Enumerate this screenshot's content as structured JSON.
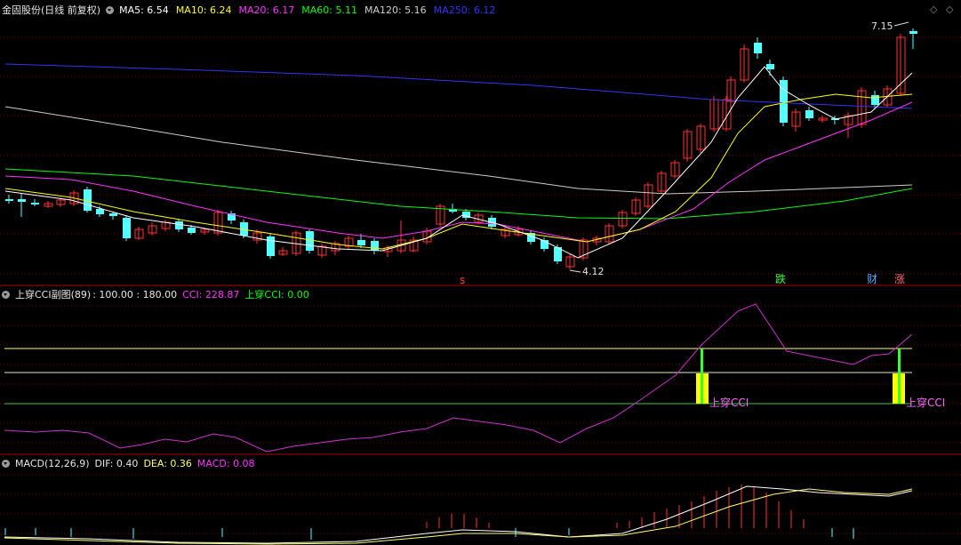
{
  "main": {
    "stock_name": "金固股份",
    "period": "(日线 前复权)",
    "ma": [
      {
        "label": "MA5:",
        "value": "6.54",
        "color": "#ffffff"
      },
      {
        "label": "MA10:",
        "value": "6.24",
        "color": "#ffff00"
      },
      {
        "label": "MA20:",
        "value": "6.17",
        "color": "#ff33ff"
      },
      {
        "label": "MA60:",
        "value": "5.11",
        "color": "#00ff00"
      },
      {
        "label": "MA120:",
        "value": "5.16",
        "color": "#cccccc"
      },
      {
        "label": "MA250:",
        "value": "6.12",
        "color": "#3333ff"
      }
    ],
    "high_label": "7.15",
    "low_label": "4.12",
    "markers": {
      "s": "s",
      "die": "跌",
      "cai": "财",
      "zhang": "涨"
    }
  },
  "cci": {
    "title": "上穿CCI副图(89)",
    "levels": ": 100.00 : 180.00",
    "cci_label": "CCI: 228.87",
    "cross_label": "上穿CCI: 0.00",
    "signal_text_1": "上穿CCI",
    "signal_text_2": "上穿CCI"
  },
  "macd": {
    "title": "MACD(12,26,9)",
    "dif": "DIF: 0.40",
    "dea": "DEA: 0.36",
    "macd": "MACD: 0.08"
  },
  "colors": {
    "up": "#ff3232",
    "down": "#54ffff",
    "grid": "#7a0000",
    "border": "#b00000"
  }
}
